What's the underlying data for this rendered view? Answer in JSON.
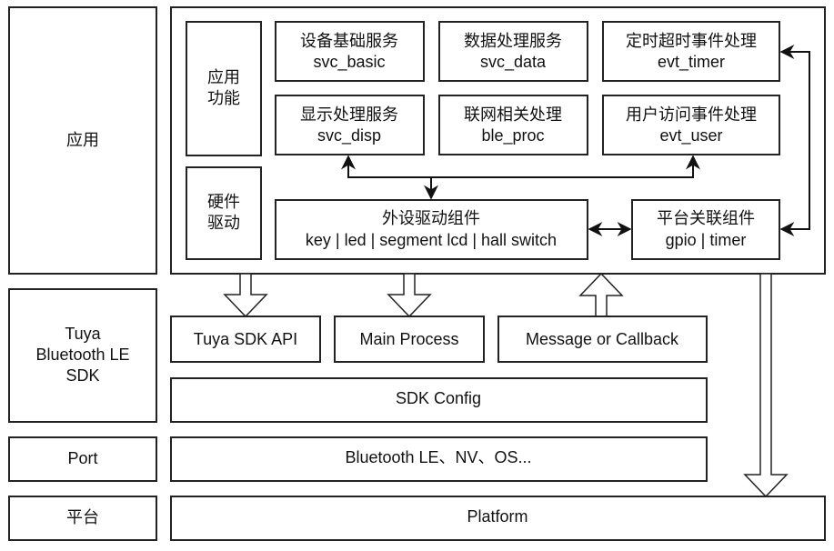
{
  "layers": {
    "app": "应用",
    "sdk": [
      "Tuya",
      "Bluetooth LE",
      "SDK"
    ],
    "port": "Port",
    "platform": "平台"
  },
  "app": {
    "app_function": [
      "应用",
      "功能"
    ],
    "hw_driver": [
      "硬件",
      "驱动"
    ],
    "services": [
      {
        "name": "设备基础服务",
        "id": "svc_basic"
      },
      {
        "name": "数据处理服务",
        "id": "svc_data"
      },
      {
        "name": "定时超时事件处理",
        "id": "evt_timer"
      },
      {
        "name": "显示处理服务",
        "id": "svc_disp"
      },
      {
        "name": "联网相关处理",
        "id": "ble_proc"
      },
      {
        "name": "用户访问事件处理",
        "id": "evt_user"
      }
    ],
    "peripheral": {
      "name": "外设驱动组件",
      "id": "key | led | segment lcd | hall switch"
    },
    "platform_component": {
      "name": "平台关联组件",
      "id": "gpio | timer"
    }
  },
  "sdk": {
    "api": "Tuya SDK API",
    "main": "Main Process",
    "message": "Message or Callback",
    "config": "SDK Config"
  },
  "port": {
    "label": "Bluetooth LE、NV、OS..."
  },
  "platform": {
    "label": "Platform"
  }
}
